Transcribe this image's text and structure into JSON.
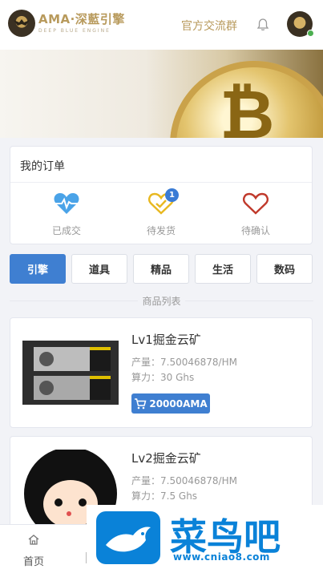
{
  "header": {
    "brand_name": "AMA·深藍引擎",
    "brand_sub": "DEEP BLUE ENGINE",
    "group_link": "官方交流群",
    "bell_icon": "bell-icon",
    "online_color": "#4caf50"
  },
  "banner": {
    "symbol": "₿"
  },
  "orders": {
    "title": "我的订单",
    "items": [
      {
        "label": "已成交",
        "icon": "heartbeat-icon",
        "color": "#4aa3e8"
      },
      {
        "label": "待发货",
        "icon": "heart-check-icon",
        "color": "#e8b820",
        "badge": "1"
      },
      {
        "label": "待确认",
        "icon": "heart-icon",
        "color": "#c0392b"
      }
    ]
  },
  "tabs": [
    {
      "label": "引擎",
      "active": true
    },
    {
      "label": "道具",
      "active": false
    },
    {
      "label": "精品",
      "active": false
    },
    {
      "label": "生活",
      "active": false
    },
    {
      "label": "数码",
      "active": false
    }
  ],
  "section_title": "商品列表",
  "products": [
    {
      "name": "Lv1掘金云矿",
      "output": "产量：7.50046878/HM",
      "power": "算力：30 Ghs",
      "price": "20000AMA"
    },
    {
      "name": "Lv2掘金云矿",
      "output": "产量：7.50046878/HM",
      "power": "算力：7.5 Ghs"
    }
  ],
  "tabbar": {
    "home_label": "首页"
  },
  "watermark": {
    "text": "菜鸟吧",
    "url": "www.cniao8.com"
  },
  "colors": {
    "accent": "#3f7fd1",
    "gold": "#b89a5c"
  }
}
